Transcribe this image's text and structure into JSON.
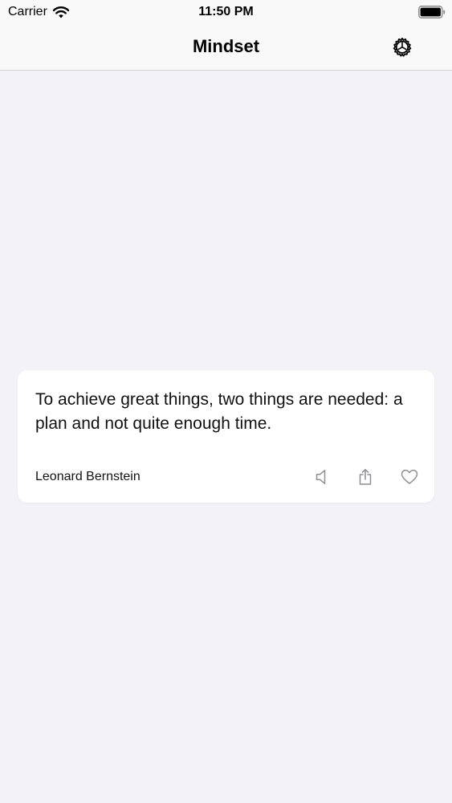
{
  "status_bar": {
    "carrier": "Carrier",
    "time": "11:50 PM",
    "icons": [
      "wifi-icon",
      "battery-icon"
    ]
  },
  "nav": {
    "title": "Mindset",
    "settings_icon": "gear-icon"
  },
  "quote": {
    "text": "To achieve great things, two things are needed: a plan and not quite enough time.",
    "author": "Leonard Bernstein",
    "actions": [
      "speaker-icon",
      "share-icon",
      "heart-icon"
    ]
  },
  "colors": {
    "background": "#f2f2f7",
    "card": "#ffffff",
    "icon_gray": "#8e8e93"
  }
}
